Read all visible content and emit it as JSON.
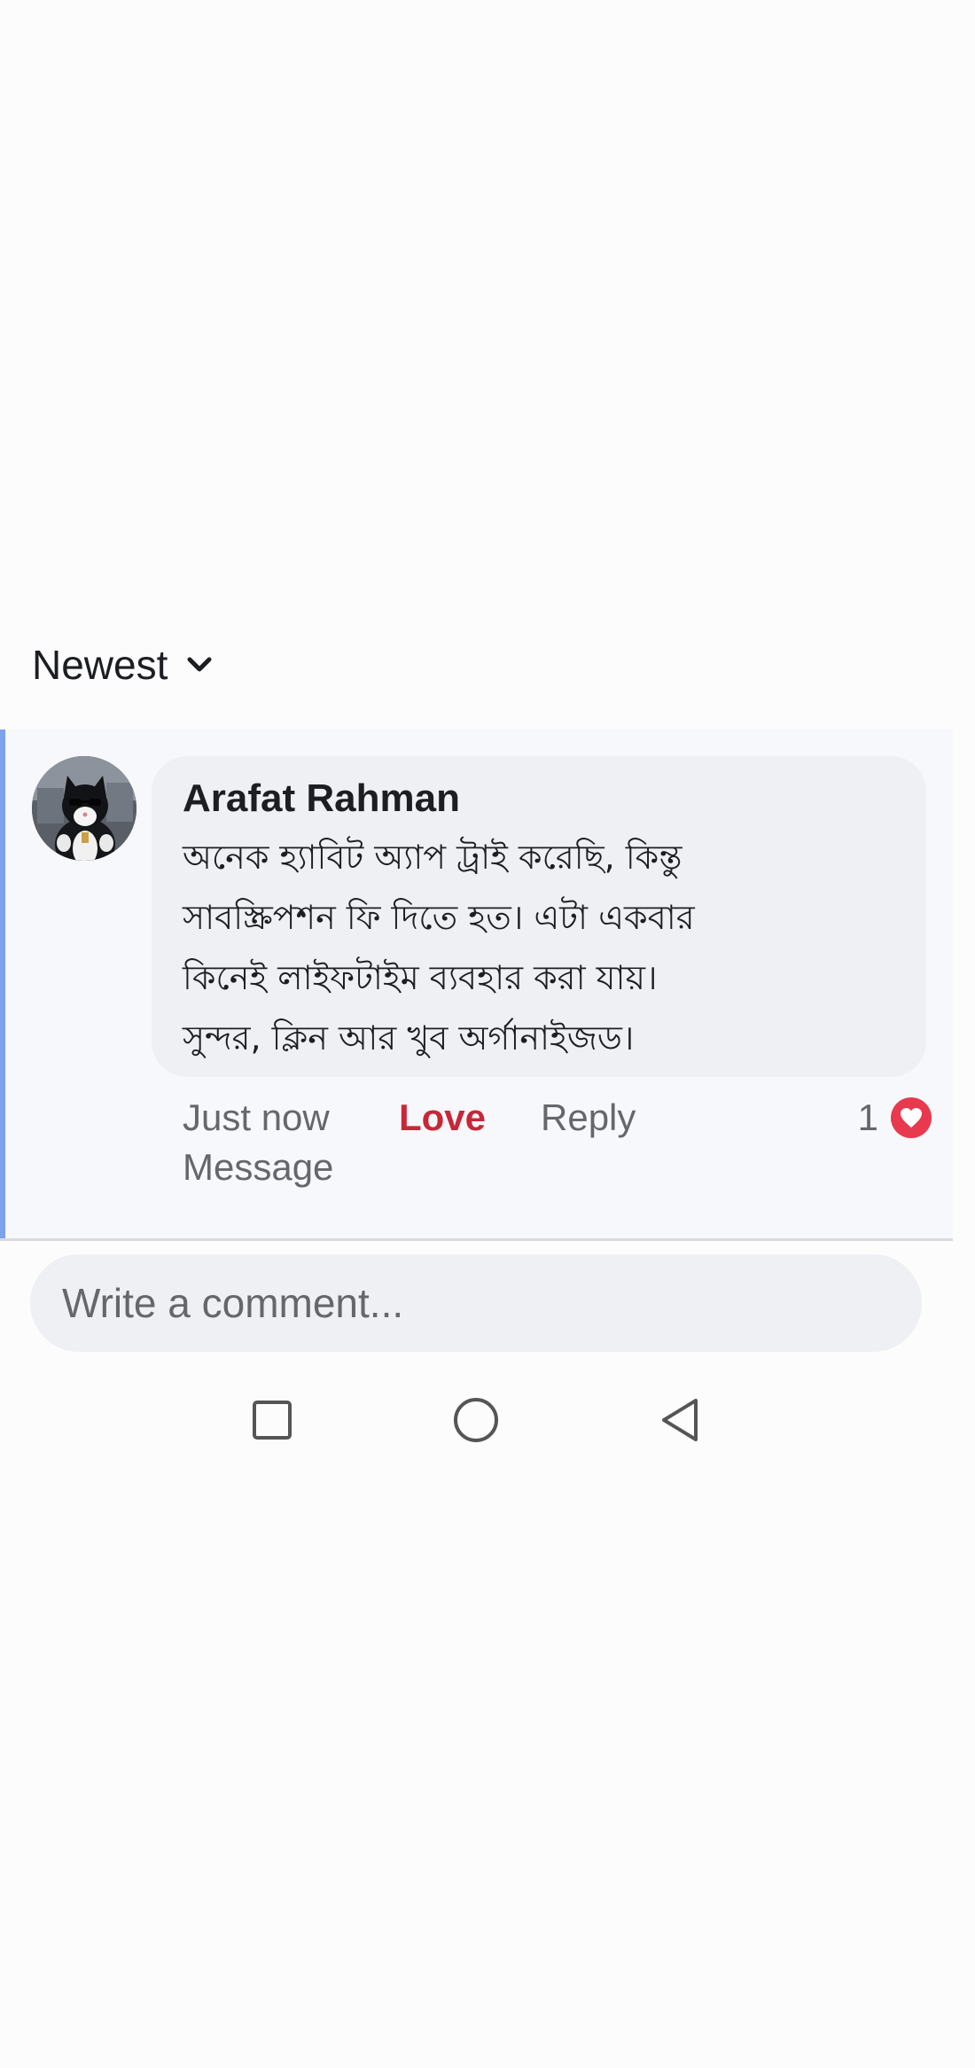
{
  "sort": {
    "label": "Newest",
    "icon": "chevron-down-icon"
  },
  "comment": {
    "author": "Arafat Rahman",
    "avatar": "cat-avatar",
    "body_lines": [
      "অনেক হ্যাবিট অ্যাপ ট্রাই করেছি, কিন্তু",
      "সাবস্ক্রিপশন ফি দিতে হত। এটা একবার",
      "কিনেই লাইফটাইম ব্যবহার করা যায়।",
      "সুন্দর, ক্লিন আর খুব অর্গানাইজড।"
    ],
    "timestamp": "Just now",
    "love_label": "Love",
    "reply_label": "Reply",
    "message_label": "Message",
    "reaction_count": "1",
    "reaction_icon": "heart-icon",
    "love_color": "#c62838",
    "accent_border_color": "#7ea2ec"
  },
  "composer": {
    "placeholder": "Write a comment..."
  },
  "nav": {
    "recent_icon": "square-icon",
    "home_icon": "circle-icon",
    "back_icon": "triangle-back-icon"
  }
}
